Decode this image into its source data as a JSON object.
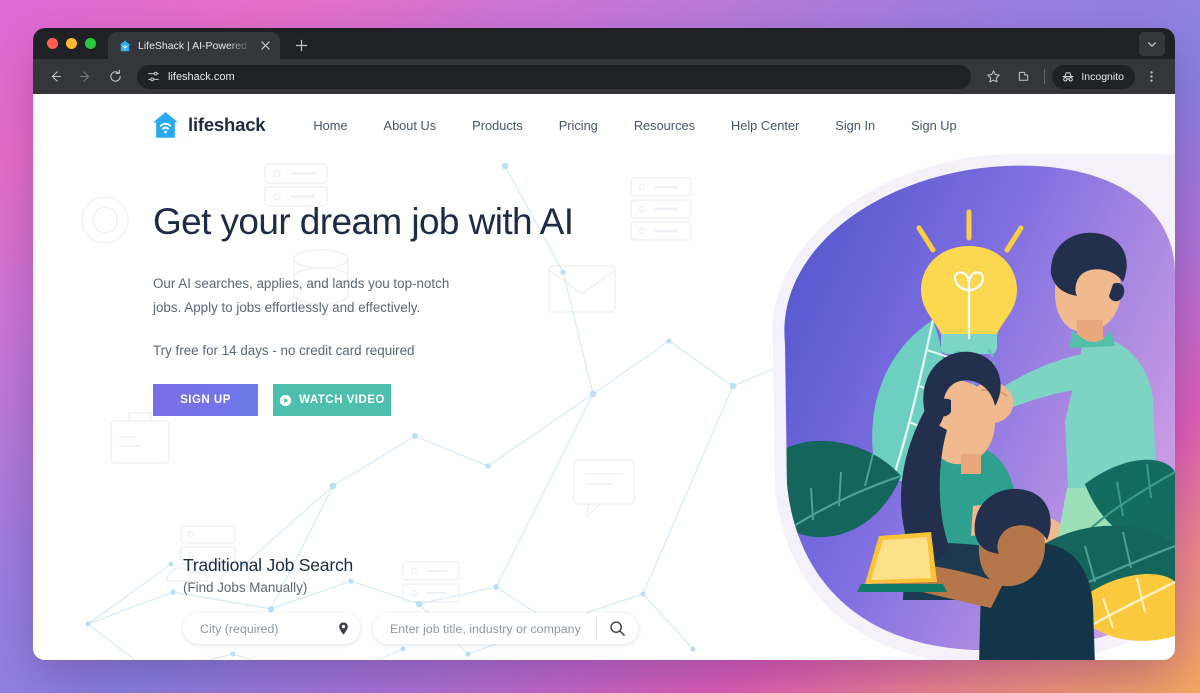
{
  "browser": {
    "tab": {
      "title": "LifeShack | AI-Powered Job S",
      "favicon_icon": "lifeshack-house-favicon",
      "close_icon": "close-icon"
    },
    "new_tab_label": "+",
    "tab_list_icon": "chevron-down-icon",
    "toolbar": {
      "back_icon": "back-arrow-icon",
      "forward_icon": "forward-arrow-icon",
      "reload_icon": "reload-icon",
      "site_settings_icon": "tune-sliders-icon",
      "url": "lifeshack.com",
      "bookmark_icon": "star-icon",
      "extensions_icon": "extensions-icon",
      "incognito_label": "Incognito",
      "incognito_icon": "incognito-hat-icon",
      "menu_icon": "three-dot-menu-icon"
    }
  },
  "site": {
    "brand": {
      "name": "lifeshack",
      "logo_icon": "house-wifi-logo"
    },
    "nav": [
      {
        "label": "Home"
      },
      {
        "label": "About Us"
      },
      {
        "label": "Products"
      },
      {
        "label": "Pricing"
      },
      {
        "label": "Resources"
      },
      {
        "label": "Help Center"
      },
      {
        "label": "Sign In"
      },
      {
        "label": "Sign Up"
      }
    ],
    "hero": {
      "title": "Get your dream job with AI",
      "subtitle_line1": "Our AI searches, applies, and lands you top-notch",
      "subtitle_line2": "jobs. Apply to jobs effortlessly and effectively.",
      "trial": "Try free for 14 days - no credit card required",
      "signup_label": "SIGN UP",
      "watch_label": "WATCH VIDEO",
      "watch_icon": "play-circle-icon",
      "illustration_icon": "teamwork-lightbulb-illustration"
    },
    "traditional_search": {
      "heading": "Traditional Job Search",
      "subheading": "(Find Jobs Manually)",
      "city_placeholder": "City (required)",
      "city_value": "",
      "city_icon": "map-pin-icon",
      "job_placeholder": "Enter job title, industry or company",
      "job_value": "",
      "search_icon": "search-icon"
    }
  },
  "colors": {
    "brand_blue": "#29a9f2",
    "navy": "#1d2b45",
    "signup_purple": "#7b6ce6",
    "watch_teal": "#4cbfad",
    "page_gradient_start": "#e06bd6",
    "page_gradient_end": "#f4a95f"
  }
}
